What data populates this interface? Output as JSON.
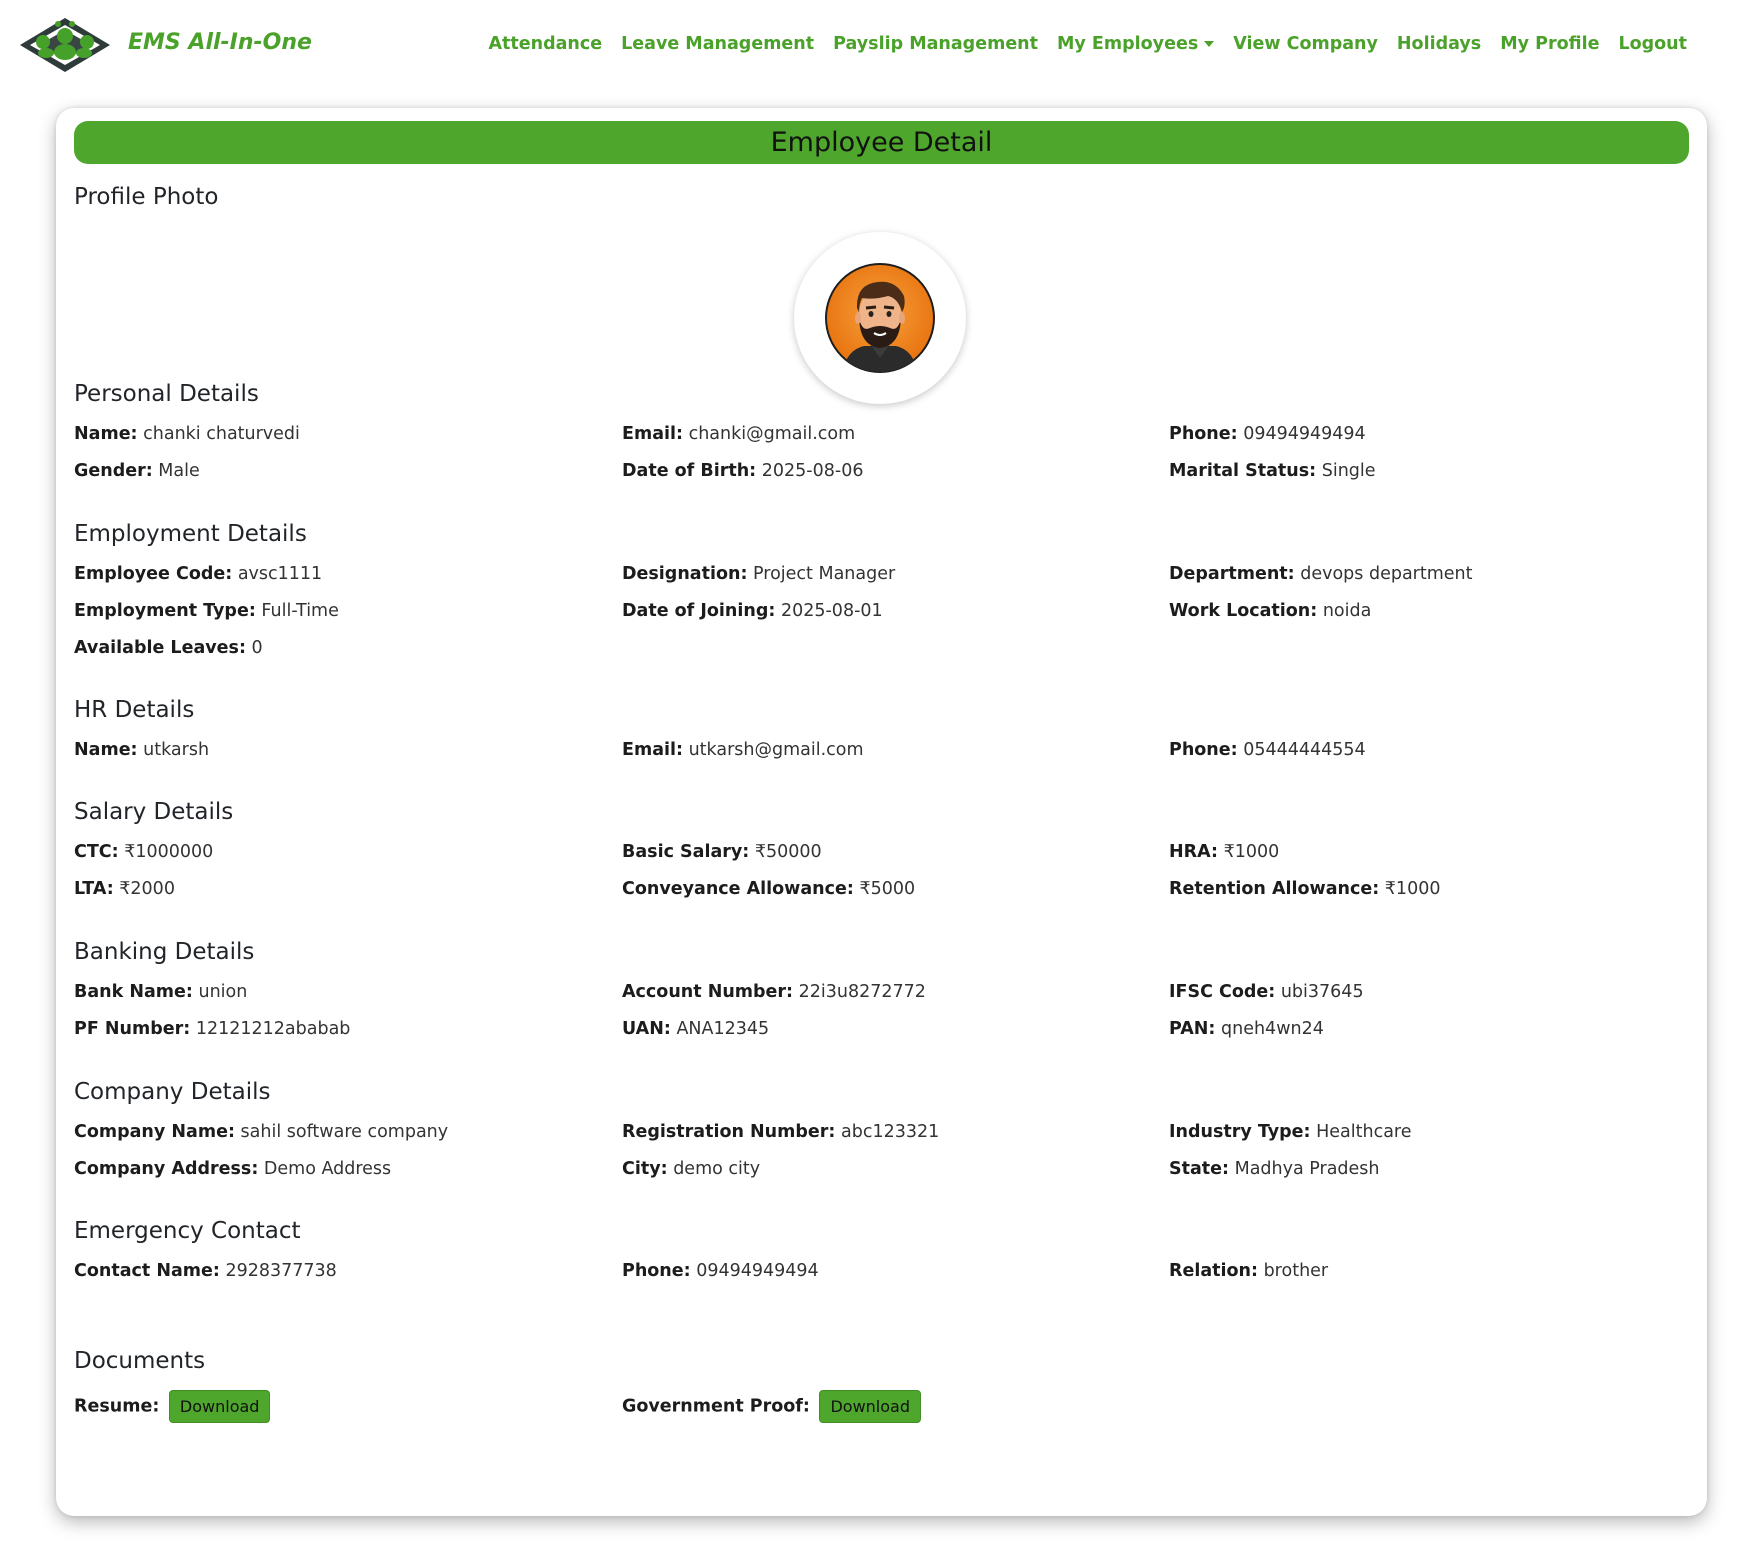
{
  "brand": {
    "name": "EMS All-In-One"
  },
  "nav": {
    "items": [
      {
        "label": "Attendance"
      },
      {
        "label": "Leave Management"
      },
      {
        "label": "Payslip Management"
      },
      {
        "label": "My Employees"
      },
      {
        "label": "View Company"
      },
      {
        "label": "Holidays"
      },
      {
        "label": "My Profile"
      },
      {
        "label": "Logout"
      }
    ]
  },
  "colors": {
    "accent": "#4ea62c",
    "brand_text": "#4aa22a"
  },
  "page": {
    "title": "Employee Detail"
  },
  "profile": {
    "title": "Profile Photo",
    "avatar_icon": "man-avatar-icon"
  },
  "personal": {
    "title": "Personal Details",
    "name_label": "Name:",
    "name": "chanki chaturvedi",
    "email_label": "Email:",
    "email": "chanki@gmail.com",
    "phone_label": "Phone:",
    "phone": "09494949494",
    "gender_label": "Gender:",
    "gender": "Male",
    "dob_label": "Date of Birth:",
    "dob": "2025-08-06",
    "marital_label": "Marital Status:",
    "marital": "Single"
  },
  "employment": {
    "title": "Employment Details",
    "code_label": "Employee Code:",
    "code": "avsc1111",
    "designation_label": "Designation:",
    "designation": "Project Manager",
    "department_label": "Department:",
    "department": "devops department",
    "type_label": "Employment Type:",
    "type": "Full-Time",
    "doj_label": "Date of Joining:",
    "doj": "2025-08-01",
    "location_label": "Work Location:",
    "location": "noida",
    "leaves_label": "Available Leaves:",
    "leaves": "0"
  },
  "hr": {
    "title": "HR Details",
    "name_label": "Name:",
    "name": "utkarsh",
    "email_label": "Email:",
    "email": "utkarsh@gmail.com",
    "phone_label": "Phone:",
    "phone": "05444444554"
  },
  "salary": {
    "title": "Salary Details",
    "ctc_label": "CTC:",
    "ctc": "₹1000000",
    "basic_label": "Basic Salary:",
    "basic": "₹50000",
    "hra_label": "HRA:",
    "hra": "₹1000",
    "lta_label": "LTA:",
    "lta": "₹2000",
    "conveyance_label": "Conveyance Allowance:",
    "conveyance": "₹5000",
    "retention_label": "Retention Allowance:",
    "retention": "₹1000"
  },
  "banking": {
    "title": "Banking Details",
    "bank_label": "Bank Name:",
    "bank": "union",
    "account_label": "Account Number:",
    "account": "22i3u8272772",
    "ifsc_label": "IFSC Code:",
    "ifsc": "ubi37645",
    "pf_label": "PF Number:",
    "pf": "12121212ababab",
    "uan_label": "UAN:",
    "uan": "ANA12345",
    "pan_label": "PAN:",
    "pan": "qneh4wn24"
  },
  "company": {
    "title": "Company Details",
    "name_label": "Company Name:",
    "name": "sahil software company",
    "reg_label": "Registration Number:",
    "reg": "abc123321",
    "industry_label": "Industry Type:",
    "industry": "Healthcare",
    "address_label": "Company Address:",
    "address": "Demo Address",
    "city_label": "City:",
    "city": "demo city",
    "state_label": "State:",
    "state": "Madhya Pradesh"
  },
  "emergency": {
    "title": "Emergency Contact",
    "name_label": "Contact Name:",
    "name": "2928377738",
    "phone_label": "Phone:",
    "phone": "09494949494",
    "relation_label": "Relation:",
    "relation": "brother"
  },
  "documents": {
    "title": "Documents",
    "resume_label": "Resume:",
    "resume_button": "Download",
    "gov_label": "Government Proof:",
    "gov_button": "Download"
  }
}
